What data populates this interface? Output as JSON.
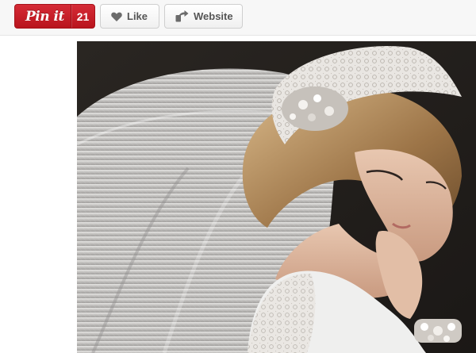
{
  "toolbar": {
    "pin_label": "Pin it",
    "pin_count": "21",
    "like_label": "Like",
    "website_label": "Website"
  },
  "icons": {
    "like": "heart-icon",
    "website": "website-share-icon"
  },
  "colors": {
    "pin_button": "#c8232c",
    "toolbar_bg": "#f7f7f7",
    "button_text": "#555555"
  }
}
